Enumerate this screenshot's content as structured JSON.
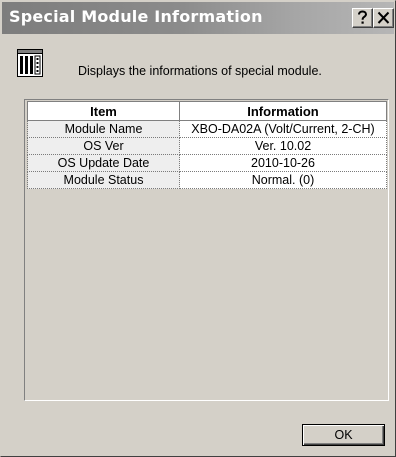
{
  "window": {
    "title": "Special Module Information",
    "help_icon": "help-question-icon",
    "close_icon": "close-x-icon"
  },
  "header": {
    "icon": "special-module-icon",
    "description": "Displays the informations of special module."
  },
  "table": {
    "columns": [
      "Item",
      "Information"
    ],
    "rows": [
      {
        "item": "Module Name",
        "info": "XBO-DA02A (Volt/Current, 2-CH)"
      },
      {
        "item": "OS Ver",
        "info": "Ver. 10.02"
      },
      {
        "item": "OS Update Date",
        "info": "2010-10-26"
      },
      {
        "item": "Module Status",
        "info": "Normal. (0)"
      }
    ]
  },
  "footer": {
    "ok_label": "OK"
  },
  "colors": {
    "dialog_face": "#d4d0c8",
    "titlebar_start": "#7d7d7d",
    "titlebar_end": "#b6b6b6",
    "title_text": "#ffffff"
  }
}
